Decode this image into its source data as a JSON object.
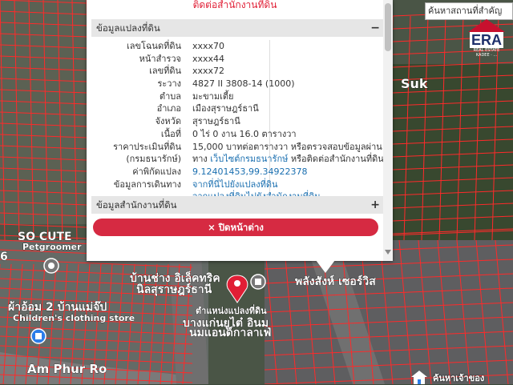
{
  "map": {
    "labels": {
      "suk": "Suk",
      "so_cute": "SO CUTE",
      "pet_groomer": "Petgroomer",
      "shop_th_1": "บ้านช่าง อิเล็คทริค",
      "shop_th_2": "นิลสุราษฎร์ธานี",
      "shop_th_3": "พลังสังห์ เซอร์วิส",
      "cloth_th": "ผ้าอ้อม 2 บ้านแม่จ๊ป",
      "cloth_en": "Children's clothing store",
      "marker_label": "ตำแหน่งแปลงที่ดิน",
      "shop_th_4": "บางแก่นยูไต๋ อินม",
      "shop_th_5": "นมแอนด์กาลาเฟ่",
      "road": "Am Phur Ro",
      "left_num": "6"
    },
    "colors": {
      "parcel_line": "#ff2a2a",
      "marker": "#e01e35"
    }
  },
  "search": {
    "label": "ค้นหาสถานที่สำคัญ"
  },
  "logo": {
    "text": "ERA",
    "sub1": "REAL ESTATE",
    "sub2": "KADEE · ..."
  },
  "bottom": {
    "text": "ค้นหาเจ้าของ"
  },
  "popup": {
    "contact_link": "ติดต่อสำนักงานที่ดิน",
    "section_parcel": "ข้อมูลแปลงที่ดิน",
    "section_parcel_toggle": "−",
    "rows": [
      {
        "label": "เลขโฉนดที่ดิน",
        "value": "xxxx70"
      },
      {
        "label": "หน้าสำรวจ",
        "value": "xxxx44"
      },
      {
        "label": "เลขที่ดิน",
        "value": "xxxx72"
      },
      {
        "label": "ระวาง",
        "value": "4827 II 3808-14 (1000)"
      },
      {
        "label": "ตำบล",
        "value": "มะขามเตี้ย"
      },
      {
        "label": "อำเภอ",
        "value": "เมืองสุราษฎร์ธานี"
      },
      {
        "label": "จังหวัด",
        "value": "สุราษฎร์ธานี"
      },
      {
        "label": "เนื้อที่",
        "value": "0 ไร่ 0 งาน 16.0 ตารางวา"
      },
      {
        "label": "ราคาประเมินที่ดิน",
        "value": "15,000 บาทต่อตารางวา หรือตรวจสอบข้อมูลผ่าน"
      }
    ],
    "row_dept": {
      "label": "(กรมธนารักษ์)",
      "prefix": "ทาง ",
      "link": "เว็บไซต์กรมธนารักษ์",
      "suffix": " หรือติดต่อสำนักงานที่ดิน"
    },
    "row_coord": {
      "label": "ค่าพิกัดแปลง",
      "link": "9.12401453,99.34922378"
    },
    "row_travel": {
      "label": "ข้อมูลการเดินทาง",
      "link1": "จากที่นี่ไปยังแปลงที่ดิน",
      "link2": "จากแปลงที่ดินไปยังสำนักงานที่ดิน"
    },
    "section_office": "ข้อมูลสำนักงานที่ดิน",
    "section_office_toggle": "+",
    "close_icon": "×",
    "close_label": "ปิดหน้าต่าง"
  }
}
